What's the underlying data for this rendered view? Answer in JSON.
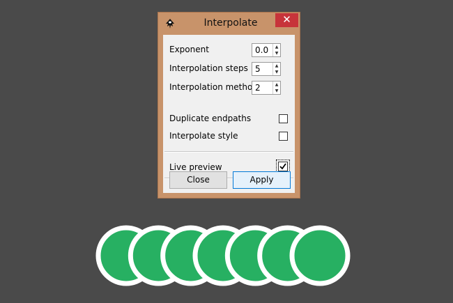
{
  "dialog": {
    "title": "Interpolate",
    "app_icon": "inkscape-icon",
    "close_glyph": "✕",
    "fields": [
      {
        "label": "Exponent",
        "value": "0.0"
      },
      {
        "label": "Interpolation steps",
        "value": "5"
      },
      {
        "label": "Interpolation method",
        "value": "2"
      }
    ],
    "checkboxes": [
      {
        "label": "Duplicate endpaths",
        "checked": false
      },
      {
        "label": "Interpolate style",
        "checked": false
      }
    ],
    "live_preview": {
      "label": "Live preview",
      "checked": true
    },
    "buttons": {
      "close_label": "Close",
      "apply_label": "Apply"
    }
  },
  "canvas": {
    "circle_count": 7,
    "fill_color": "#27b062",
    "stroke_color": "#ffffff"
  },
  "colors": {
    "window_frame": "#c8936a",
    "close_button": "#c7343a",
    "canvas_background": "#4a4a4a"
  }
}
